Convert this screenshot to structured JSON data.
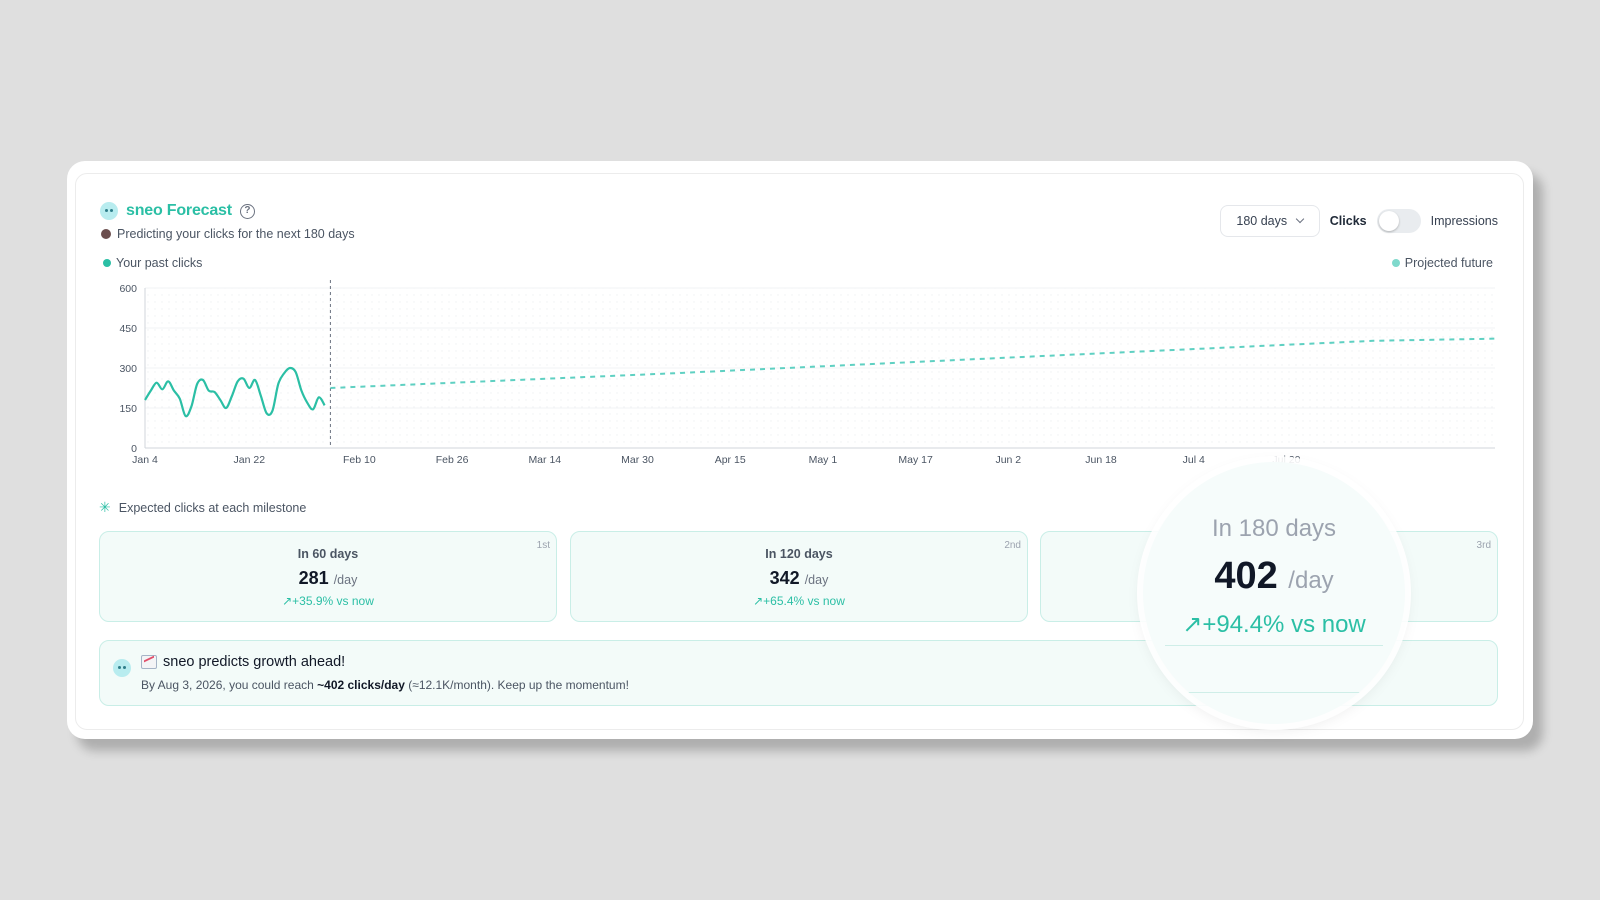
{
  "header": {
    "title": "sneo Forecast",
    "subtitle": "Predicting your clicks for the next 180 days"
  },
  "controls": {
    "period": "180 days",
    "toggle_left": "Clicks",
    "toggle_right": "Impressions",
    "toggle_state": "Clicks"
  },
  "legend": {
    "past": "Your past clicks",
    "future": "Projected future"
  },
  "colors": {
    "accent": "#2bbfa5",
    "projected": "#5fd0c2",
    "grid": "#eef0f2"
  },
  "chart_data": {
    "type": "line",
    "ylim": [
      0,
      600
    ],
    "y_ticks": [
      "0",
      "150",
      "300",
      "450",
      "600"
    ],
    "x_tick_labels": [
      "Jan 4",
      "Jan 22",
      "Feb 10",
      "Feb 26",
      "Mar 14",
      "Mar 30",
      "Apr 15",
      "May 1",
      "May 17",
      "Jun 2",
      "Jun 18",
      "Jul 4",
      "Jul 20"
    ],
    "x_tick_days": [
      0,
      18,
      37,
      53,
      69,
      85,
      101,
      117,
      133,
      149,
      165,
      181,
      197
    ],
    "x_range_days": [
      0,
      233
    ],
    "today_day": 32,
    "series": [
      {
        "name": "Your past clicks",
        "style": "solid",
        "x": [
          0,
          1,
          2,
          3,
          4,
          5,
          6,
          7,
          8,
          9,
          10,
          11,
          12,
          13,
          14,
          15,
          16,
          17,
          18,
          19,
          20,
          21,
          22,
          23,
          24,
          25,
          26,
          27,
          28,
          29,
          30,
          31
        ],
        "y": [
          180,
          215,
          245,
          220,
          250,
          215,
          185,
          120,
          155,
          240,
          255,
          215,
          210,
          180,
          150,
          195,
          250,
          260,
          225,
          255,
          195,
          130,
          140,
          240,
          280,
          300,
          285,
          215,
          170,
          145,
          190,
          160
        ]
      },
      {
        "name": "Projected future",
        "style": "dashed",
        "x": [
          32,
          92,
          152,
          212,
          233
        ],
        "y": [
          225,
          281,
          342,
          402,
          410
        ]
      }
    ]
  },
  "milestones": {
    "heading": "Expected clicks at each milestone",
    "items": [
      {
        "label": "In 60 days",
        "value": "281",
        "unit": "/day",
        "change": "+35.9% vs now",
        "rank": "1st"
      },
      {
        "label": "In 120 days",
        "value": "342",
        "unit": "/day",
        "change": "+65.4% vs now",
        "rank": "2nd"
      },
      {
        "label": "In 180 days",
        "value": "402",
        "unit": "/day",
        "change": "+94.4% vs now",
        "rank": "3rd"
      }
    ]
  },
  "banner": {
    "title": "sneo predicts growth ahead!",
    "text_prefix": "By Aug 3, 2026, you could reach",
    "text_bold": "~402 clicks/day",
    "text_suffix": "(≈12.1K/month). Keep up the momentum!"
  }
}
